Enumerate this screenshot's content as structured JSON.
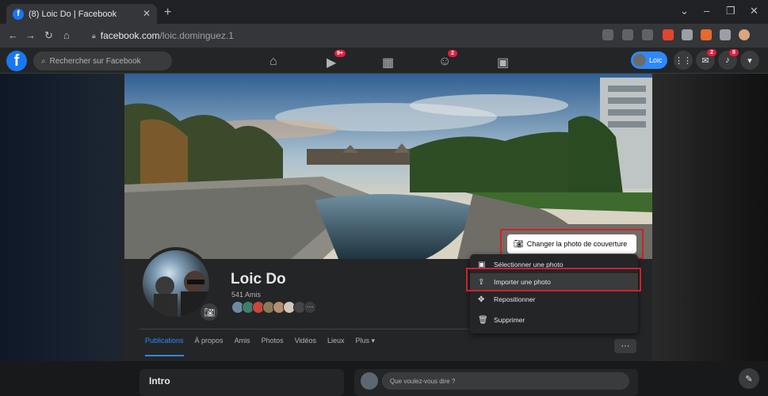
{
  "browser": {
    "tab_title": "(8) Loic Do | Facebook",
    "tab_close": "✕",
    "new_tab": "+",
    "url_host": "facebook.com",
    "url_path": "/loic.dominguez.1",
    "minimize": "⌄",
    "restore": "–",
    "maximize": "❐",
    "close": "✕"
  },
  "fb_bar": {
    "logo": "f",
    "search_placeholder": "Rechercher sur Facebook",
    "watch_badge": "9+",
    "groups_badge": "2",
    "chip_label": "Loic",
    "notif_badges": [
      "2",
      "8"
    ],
    "colors": {
      "bar": "#242526",
      "accent": "#1877f2"
    }
  },
  "profile": {
    "name": "Loic Do",
    "friends": "541 Amis",
    "change_cover": "Changer la photo de couverture"
  },
  "cover_menu": {
    "items": [
      {
        "label": "Sélectionner une photo",
        "icon": "image-icon"
      },
      {
        "label": "Importer une photo",
        "icon": "upload-icon"
      },
      {
        "label": "Repositionner",
        "icon": "move-icon"
      },
      {
        "label": "Supprimer",
        "icon": "trash-icon"
      }
    ]
  },
  "tabs": [
    "Publications",
    "À propos",
    "Amis",
    "Photos",
    "Vidéos",
    "Lieux",
    "Plus ▾"
  ],
  "more_label": "···",
  "intro": {
    "title": "Intro"
  },
  "post": {
    "placeholder": "Que voulez-vous dire ?"
  },
  "highlight_color": "#d0202b"
}
